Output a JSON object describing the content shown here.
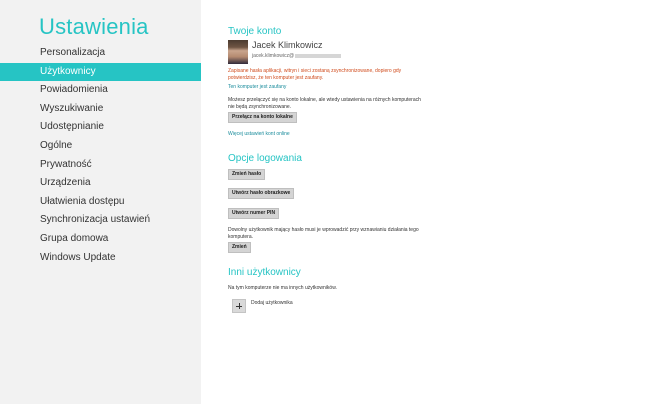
{
  "sidebar": {
    "title": "Ustawienia",
    "items": [
      {
        "label": "Personalizacja"
      },
      {
        "label": "Użytkownicy"
      },
      {
        "label": "Powiadomienia"
      },
      {
        "label": "Wyszukiwanie"
      },
      {
        "label": "Udostępnianie"
      },
      {
        "label": "Ogólne"
      },
      {
        "label": "Prywatność"
      },
      {
        "label": "Urządzenia"
      },
      {
        "label": "Ułatwienia dostępu"
      },
      {
        "label": "Synchronizacja ustawień"
      },
      {
        "label": "Grupa domowa"
      },
      {
        "label": "Windows Update"
      }
    ],
    "active_index": 1
  },
  "account": {
    "section_title": "Twoje konto",
    "user_name": "Jacek Klimkowicz",
    "email_prefix": "jacek.klimkowicz@",
    "warning": "Zapisane hasła aplikacji, witryn i sieci zostaną zsynchronizowane, dopiero gdy potwierdzisz, że ten komputer jest zaufany.",
    "trust_link": "Ten komputer jest zaufany",
    "switch_text": "Możesz przełączyć się na konto lokalne, ale wtedy ustawienia na różnych komputerach nie będą zsynchronizowane.",
    "switch_button": "Przełącz na konto lokalne",
    "more_link": "Więcej ustawień kont online"
  },
  "login": {
    "section_title": "Opcje logowania",
    "change_password": "Zmień hasło",
    "picture_password": "Utwórz hasło obrazkowe",
    "pin": "Utwórz numer PIN",
    "wake_text": "Dowolny użytkownik mający hasło musi je wprowadzić przy wznawianiu działania tego komputera.",
    "change_button": "Zmień"
  },
  "others": {
    "section_title": "Inni użytkownicy",
    "empty_text": "Na tym komputerze nie ma innych użytkowników.",
    "add_user": "Dodaj użytkownika"
  },
  "colors": {
    "accent": "#26c4c4",
    "warning": "#d04b1c",
    "link": "#1a8c9c"
  }
}
